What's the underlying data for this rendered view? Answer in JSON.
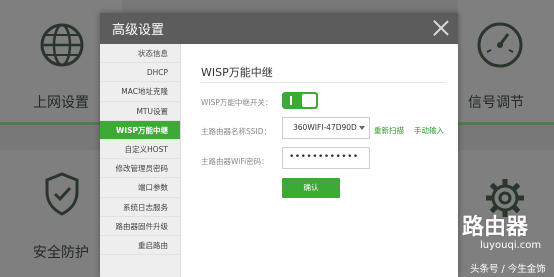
{
  "background": {
    "tiles": {
      "internet": "上网设置",
      "signal": "信号调节",
      "security": "安全防护"
    }
  },
  "modal": {
    "title": "高级设置",
    "sidebar": [
      {
        "label": "状态信息",
        "active": false
      },
      {
        "label": "DHCP",
        "active": false
      },
      {
        "label": "MAC地址克隆",
        "active": false
      },
      {
        "label": "MTU设置",
        "active": false
      },
      {
        "label": "WISP万能中继",
        "active": true
      },
      {
        "label": "自定义HOST",
        "active": false
      },
      {
        "label": "修改管理员密码",
        "active": false
      },
      {
        "label": "端口参数",
        "active": false
      },
      {
        "label": "系统日志服务",
        "active": false
      },
      {
        "label": "路由器固件升级",
        "active": false
      },
      {
        "label": "重启路由",
        "active": false
      }
    ],
    "content": {
      "heading": "WISP万能中继",
      "switch_label": "WISP万能中继开关：",
      "switch_pipe": "I",
      "ssid_label": "主路由器名称SSID：",
      "ssid_value": "360WIFI-47D90D",
      "rescan_label": "重新扫描",
      "manual_label": "手动输入",
      "password_label": "主路由器WiFi密码：",
      "password_value": "••••••••••••",
      "confirm_label": "确认"
    }
  },
  "watermark": {
    "brand": "路由器",
    "domain": "luyouqi.com",
    "credit": "头条号 / 今生金饰"
  },
  "colors": {
    "accent": "#3daa36",
    "header": "#5c5c5c"
  }
}
